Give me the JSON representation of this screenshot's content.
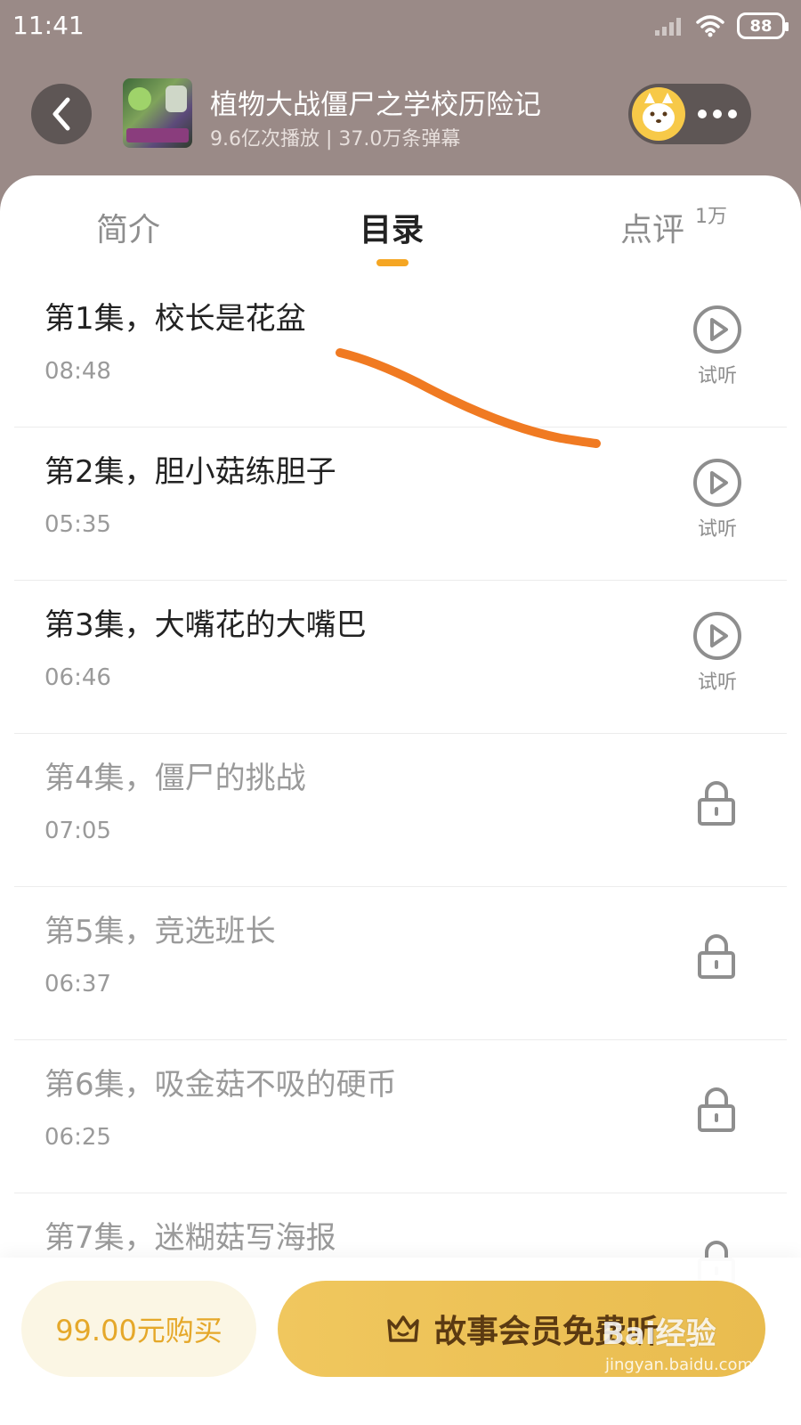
{
  "status_bar": {
    "time": "11:41",
    "battery": "88",
    "icons": [
      "signal-icon",
      "wifi-icon",
      "battery-icon"
    ]
  },
  "header": {
    "title": "植物大战僵尸之学校历险记",
    "stats": "9.6亿次播放 | 37.0万条弹幕",
    "back_icon": "chevron-left-icon",
    "more_icon": "more-dots-icon"
  },
  "tabs": {
    "items": [
      {
        "label": "简介"
      },
      {
        "label": "目录"
      },
      {
        "label": "点评"
      }
    ],
    "active_index": 1,
    "comment_badge": "1万",
    "accent_color": "#f5a623"
  },
  "episodes": [
    {
      "title": "第1集，校长是花盆",
      "duration": "08:48",
      "action": "试听",
      "locked": false
    },
    {
      "title": "第2集，胆小菇练胆子",
      "duration": "05:35",
      "action": "试听",
      "locked": false
    },
    {
      "title": "第3集，大嘴花的大嘴巴",
      "duration": "06:46",
      "action": "试听",
      "locked": false
    },
    {
      "title": "第4集，僵尸的挑战",
      "duration": "07:05",
      "locked": true
    },
    {
      "title": "第5集，竞选班长",
      "duration": "06:37",
      "locked": true
    },
    {
      "title": "第6集，吸金菇不吸的硬币",
      "duration": "06:25",
      "locked": true
    },
    {
      "title": "第7集，迷糊菇写海报",
      "locked": true
    }
  ],
  "bottom_bar": {
    "buy_label": "99.00元购买",
    "member_label": "故事会员免费听",
    "member_icon": "crown-icon"
  },
  "watermark": {
    "brand": "Bai经验",
    "url": "jingyan.baidu.com"
  }
}
